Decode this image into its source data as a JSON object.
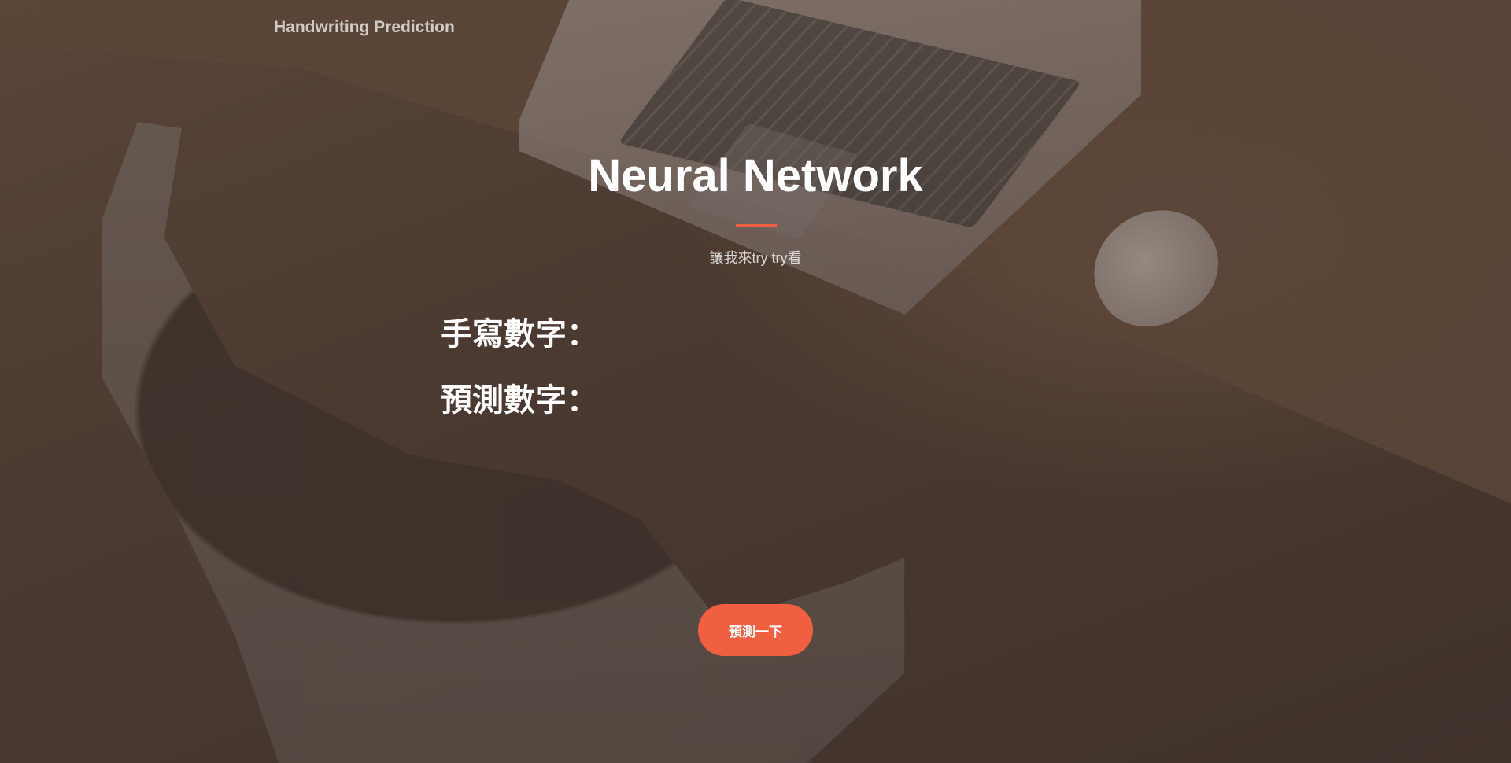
{
  "nav": {
    "brand": "Handwriting Prediction"
  },
  "hero": {
    "title": "Neural Network",
    "subtitle": "讓我來try try看"
  },
  "form": {
    "handwritten_label": "手寫數字：",
    "predicted_label": "預測數字：",
    "predict_button": "預測一下"
  },
  "colors": {
    "accent": "#f05f40",
    "text": "#ffffff",
    "background": "#4a3b33"
  }
}
